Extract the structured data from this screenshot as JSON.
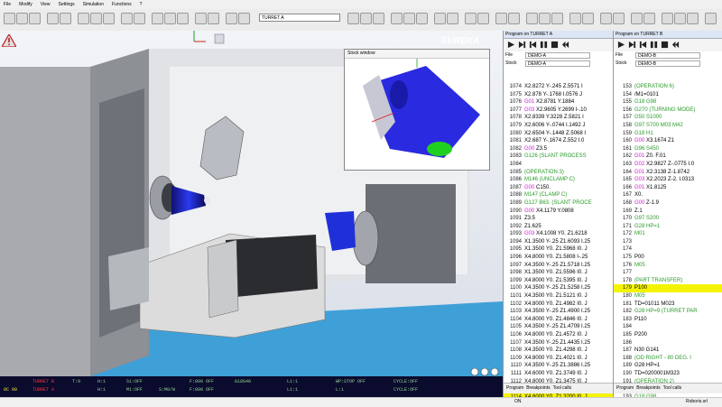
{
  "menu": [
    "File",
    "Modify",
    "View",
    "Settings",
    "Simulation",
    "Functions",
    "?"
  ],
  "toolbar": {
    "machine_select": "TURRET A"
  },
  "viewport": {
    "logo": "EUREKA",
    "stock_window_title": "Stock window"
  },
  "status": {
    "row1": [
      "TURRET B",
      "T:9",
      "H:1",
      "S1:OFF",
      "F:000 OFF",
      "G18G40",
      "L1:1",
      "WP:STOP OFF",
      "CYCLE:OFF"
    ],
    "row2": [
      "0C 00",
      "TURRET A",
      "H:1",
      "M1:OFF",
      "S:M0/W",
      "F:000 OFF",
      "L1:1",
      "L:1",
      "CYCLE:OFF"
    ]
  },
  "sysbar": {
    "left": "ON",
    "right": "Roboris.srl"
  },
  "panel_a": {
    "title": "Program on TURRET A",
    "file_label": "File",
    "file_value": "DEMO-A",
    "stock_label": "Stock",
    "stock_value": "DEMO-A",
    "tabs": [
      "Program",
      "Breakpoints",
      "Tool calls"
    ],
    "lines": [
      {
        "n": "1074",
        "t": "X2.8272 Y-.245 Z.5571 I",
        "c": "#000"
      },
      {
        "n": "1075",
        "t": "X2.878 Y-.1768 I.0576 J",
        "c": "#000"
      },
      {
        "n": "1076",
        "t": "G01 X2.8781 Y.1884",
        "c": "#000",
        "k": "G01"
      },
      {
        "n": "1077",
        "t": "G03 X2.9605 Y.2699 I-.10",
        "c": "#000",
        "k": "G03"
      },
      {
        "n": "1078",
        "t": "X2.8339 Y.3228 Z.5821 I",
        "c": "#000"
      },
      {
        "n": "1079",
        "t": "X2.6006 Y-.0744 I.1492 J",
        "c": "#000"
      },
      {
        "n": "1080",
        "t": "X2.6504 Y-.1448 Z.5068 I",
        "c": "#000"
      },
      {
        "n": "1081",
        "t": "X2.687 Y-.1674 Z.552 I.0",
        "c": "#000"
      },
      {
        "n": "1082",
        "t": "G00 Z3.5",
        "c": "#000",
        "k": "G00"
      },
      {
        "n": "1083",
        "t": "G126 (SLANT PROCESS",
        "c": "#2a9a2a"
      },
      {
        "n": "1084",
        "t": "",
        "c": "#000"
      },
      {
        "n": "1085",
        "t": "(OPERATION 3)",
        "c": "#2a9a2a"
      },
      {
        "n": "1086",
        "t": "M146 (UNCLAMP C)",
        "c": "#2a9a2a"
      },
      {
        "n": "1087",
        "t": "G00 C150.",
        "c": "#000",
        "k": "G00"
      },
      {
        "n": "1088",
        "t": "M147 (CLAMP C)",
        "c": "#2a9a2a"
      },
      {
        "n": "1089",
        "t": "G127 B63. (SLANT PROCE",
        "c": "#2a9a2a"
      },
      {
        "n": "1090",
        "t": "G00 X4.1179 Y.0808",
        "c": "#000",
        "k": "G00"
      },
      {
        "n": "1091",
        "t": "Z3.5",
        "c": "#000"
      },
      {
        "n": "1092",
        "t": "Z1.625",
        "c": "#000"
      },
      {
        "n": "1093",
        "t": "G03 X4.1008 Y0. Z1.6218",
        "c": "#000",
        "k": "G03"
      },
      {
        "n": "1094",
        "t": "X1.3500 Y-.25 Z1.6093 I.25",
        "c": "#000"
      },
      {
        "n": "1095",
        "t": "X1.3500 Y0. Z1.5968 I0. J",
        "c": "#000"
      },
      {
        "n": "1096",
        "t": "X4.8000 Y0. Z1.5808 I-.25",
        "c": "#000"
      },
      {
        "n": "1097",
        "t": "X4.3500 Y-.25 Z1.5718 I.25",
        "c": "#000"
      },
      {
        "n": "1098",
        "t": "X1.3500 Y0. Z1.5596 I0. J",
        "c": "#000"
      },
      {
        "n": "1099",
        "t": "X4.8000 Y0. Z1.5395 I0. J",
        "c": "#000"
      },
      {
        "n": "1100",
        "t": "X4.3500 Y-.25 Z1.5258 I.25",
        "c": "#000"
      },
      {
        "n": "1101",
        "t": "X4.3500 Y0. Z1.5121 I0. J",
        "c": "#000"
      },
      {
        "n": "1102",
        "t": "X4.8000 Y0. Z1.4982 I0. J",
        "c": "#000"
      },
      {
        "n": "1103",
        "t": "X4.3500 Y-.25 Z1.4900 I.25",
        "c": "#000"
      },
      {
        "n": "1104",
        "t": "X4.8000 Y0. Z1.4846 I0. J",
        "c": "#000"
      },
      {
        "n": "1105",
        "t": "X4.3500 Y-.25 Z1.4709 I.25",
        "c": "#000"
      },
      {
        "n": "1106",
        "t": "X4.8000 Y0. Z1.4572 I0. J",
        "c": "#000"
      },
      {
        "n": "1107",
        "t": "X4.3500 Y-.25 Z1.4435 I.25",
        "c": "#000"
      },
      {
        "n": "1108",
        "t": "X4.3500 Y0. Z1.4298 I0. J",
        "c": "#000"
      },
      {
        "n": "1109",
        "t": "X4.8000 Y0. Z1.4021 I0. J",
        "c": "#000"
      },
      {
        "n": "1110",
        "t": "X4.3500 Y-.25 Z1.3886 I.25",
        "c": "#000"
      },
      {
        "n": "1111",
        "t": "X4.6000 Y0. Z1.3749 I0. J",
        "c": "#000"
      },
      {
        "n": "1112",
        "t": "X4.8000 Y0. Z1.3475 I0. J",
        "c": "#000"
      },
      {
        "n": "1113",
        "t": "X4.3500 Y-.25 Z1.3338 I.25",
        "c": "#000"
      },
      {
        "n": "1114",
        "t": "X4.6000 Y0. Z1.3200 I0. J",
        "c": "#000",
        "hl": true
      }
    ]
  },
  "panel_b": {
    "title": "Program on TURRET B",
    "file_label": "File",
    "file_value": "DEMO-B",
    "stock_label": "Stock",
    "stock_value": "DEMO-B",
    "tabs": [
      "Program",
      "Breakpoints",
      "Tool calls"
    ],
    "lines": [
      {
        "n": "153",
        "t": "(OPERATION 6)",
        "c": "#2a9a2a"
      },
      {
        "n": "154",
        "t": "/M1=0101",
        "c": "#000"
      },
      {
        "n": "155",
        "t": "G18 G98",
        "c": "#2a9a2a"
      },
      {
        "n": "156",
        "t": "G270 (TURNING MODE)",
        "c": "#2a9a2a"
      },
      {
        "n": "157",
        "t": "G50 S1000",
        "c": "#2a9a2a"
      },
      {
        "n": "158",
        "t": "G97 S700 M03 M42",
        "c": "#2a9a2a"
      },
      {
        "n": "159",
        "t": "G18 H1",
        "c": "#2a9a2a"
      },
      {
        "n": "160",
        "t": "G00 X3.1674 Z1",
        "c": "#000",
        "k": "G00"
      },
      {
        "n": "161",
        "t": "G96 S450",
        "c": "#2a9a2a"
      },
      {
        "n": "162",
        "t": "G01 Z0. F.01",
        "c": "#000",
        "k": "G01"
      },
      {
        "n": "163",
        "t": "G02 X2.9827 Z-.0775 I.0",
        "c": "#000",
        "k": "G02"
      },
      {
        "n": "164",
        "t": "G01 X2.3138 Z-1.8742",
        "c": "#000",
        "k": "G01"
      },
      {
        "n": "165",
        "t": "G03 X2.2023 Z-2. I.0313",
        "c": "#000",
        "k": "G03"
      },
      {
        "n": "166",
        "t": "G01 X1.8125",
        "c": "#000",
        "k": "G01"
      },
      {
        "n": "167",
        "t": "X0.",
        "c": "#000"
      },
      {
        "n": "168",
        "t": "G00 Z-1.9",
        "c": "#000",
        "k": "G00"
      },
      {
        "n": "169",
        "t": "Z.1",
        "c": "#000"
      },
      {
        "n": "170",
        "t": "G97 S200",
        "c": "#2a9a2a"
      },
      {
        "n": "171",
        "t": "G28 HP=1",
        "c": "#2a9a2a"
      },
      {
        "n": "172",
        "t": "M01",
        "c": "#2a9a2a"
      },
      {
        "n": "173",
        "t": "",
        "c": "#000"
      },
      {
        "n": "174",
        "t": "",
        "c": "#000"
      },
      {
        "n": "175",
        "t": "P00",
        "c": "#000"
      },
      {
        "n": "176",
        "t": "M05",
        "c": "#2a9a2a"
      },
      {
        "n": "177",
        "t": "",
        "c": "#000"
      },
      {
        "n": "178",
        "t": "(PART TRANSFER)",
        "c": "#2a9a2a"
      },
      {
        "n": "179",
        "t": "P100",
        "c": "#000",
        "hl": true
      },
      {
        "n": "180",
        "t": "M05",
        "c": "#2a9a2a"
      },
      {
        "n": "181",
        "t": "TD=01011 M023",
        "c": "#000"
      },
      {
        "n": "182",
        "t": "G28 HP=9 (TURRET PAR",
        "c": "#2a9a2a"
      },
      {
        "n": "183",
        "t": "P110",
        "c": "#000"
      },
      {
        "n": "184",
        "t": "",
        "c": "#000"
      },
      {
        "n": "185",
        "t": "P200",
        "c": "#000"
      },
      {
        "n": "186",
        "t": "",
        "c": "#000"
      },
      {
        "n": "187",
        "t": "N30 G141",
        "c": "#000"
      },
      {
        "n": "188",
        "t": "(OD RIGHT - 80 DEG. I",
        "c": "#2a9a2a"
      },
      {
        "n": "189",
        "t": "G28 HP=1",
        "c": "#000"
      },
      {
        "n": "190",
        "t": "TD=0200001M323",
        "c": "#000"
      },
      {
        "n": "191",
        "t": "(OPERATION 2)",
        "c": "#2a9a2a"
      },
      {
        "n": "192",
        "t": "G270 (TURNING MODE)",
        "c": "#2a9a2a"
      },
      {
        "n": "193",
        "t": "G18 G98",
        "c": "#2a9a2a"
      }
    ]
  },
  "colors": {
    "accent_g": "#d020d0",
    "highlight": "#f4f400",
    "comment": "#2a9a2a",
    "status_bg": "#0b0b2e"
  }
}
